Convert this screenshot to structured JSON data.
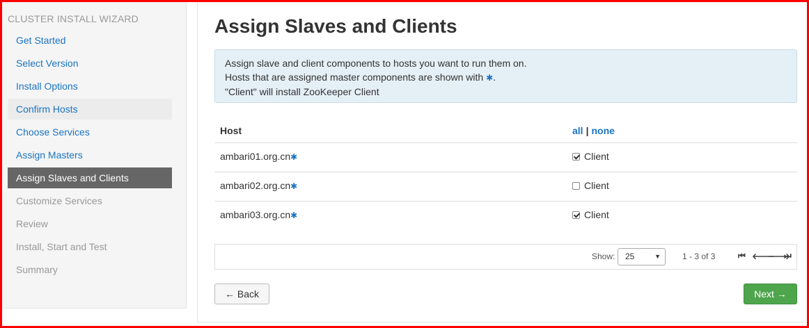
{
  "sidebar": {
    "title": "CLUSTER INSTALL WIZARD",
    "items": [
      {
        "label": "Get Started",
        "state": "link"
      },
      {
        "label": "Select Version",
        "state": "link"
      },
      {
        "label": "Install Options",
        "state": "link"
      },
      {
        "label": "Confirm Hosts",
        "state": "done"
      },
      {
        "label": "Choose Services",
        "state": "link"
      },
      {
        "label": "Assign Masters",
        "state": "link"
      },
      {
        "label": "Assign Slaves and Clients",
        "state": "active"
      },
      {
        "label": "Customize Services",
        "state": "disabled"
      },
      {
        "label": "Review",
        "state": "disabled"
      },
      {
        "label": "Install, Start and Test",
        "state": "disabled"
      },
      {
        "label": "Summary",
        "state": "disabled"
      }
    ]
  },
  "main": {
    "title": "Assign Slaves and Clients",
    "info": {
      "line1": "Assign slave and client components to hosts you want to run them on.",
      "line2_prefix": "Hosts that are assigned master components are shown with",
      "line2_suffix": ".",
      "line3": "\"Client\" will install ZooKeeper Client",
      "master_icon": "✱"
    },
    "table": {
      "host_header": "Host",
      "all_link": "all",
      "separator": "|",
      "none_link": "none",
      "rows": [
        {
          "host": "ambari01.org.cn",
          "component": "Client",
          "checked": true
        },
        {
          "host": "ambari02.org.cn",
          "component": "Client",
          "checked": false
        },
        {
          "host": "ambari03.org.cn",
          "component": "Client",
          "checked": true
        }
      ]
    },
    "pager": {
      "show_label": "Show:",
      "page_size": "25",
      "range": "1 - 3 of 3"
    },
    "buttons": {
      "back": "← Back",
      "next": "Next →"
    }
  },
  "colors": {
    "link": "#1a74c2",
    "active_nav": "#666666",
    "next_button": "#4ea54c",
    "frame": "#ff0000"
  }
}
